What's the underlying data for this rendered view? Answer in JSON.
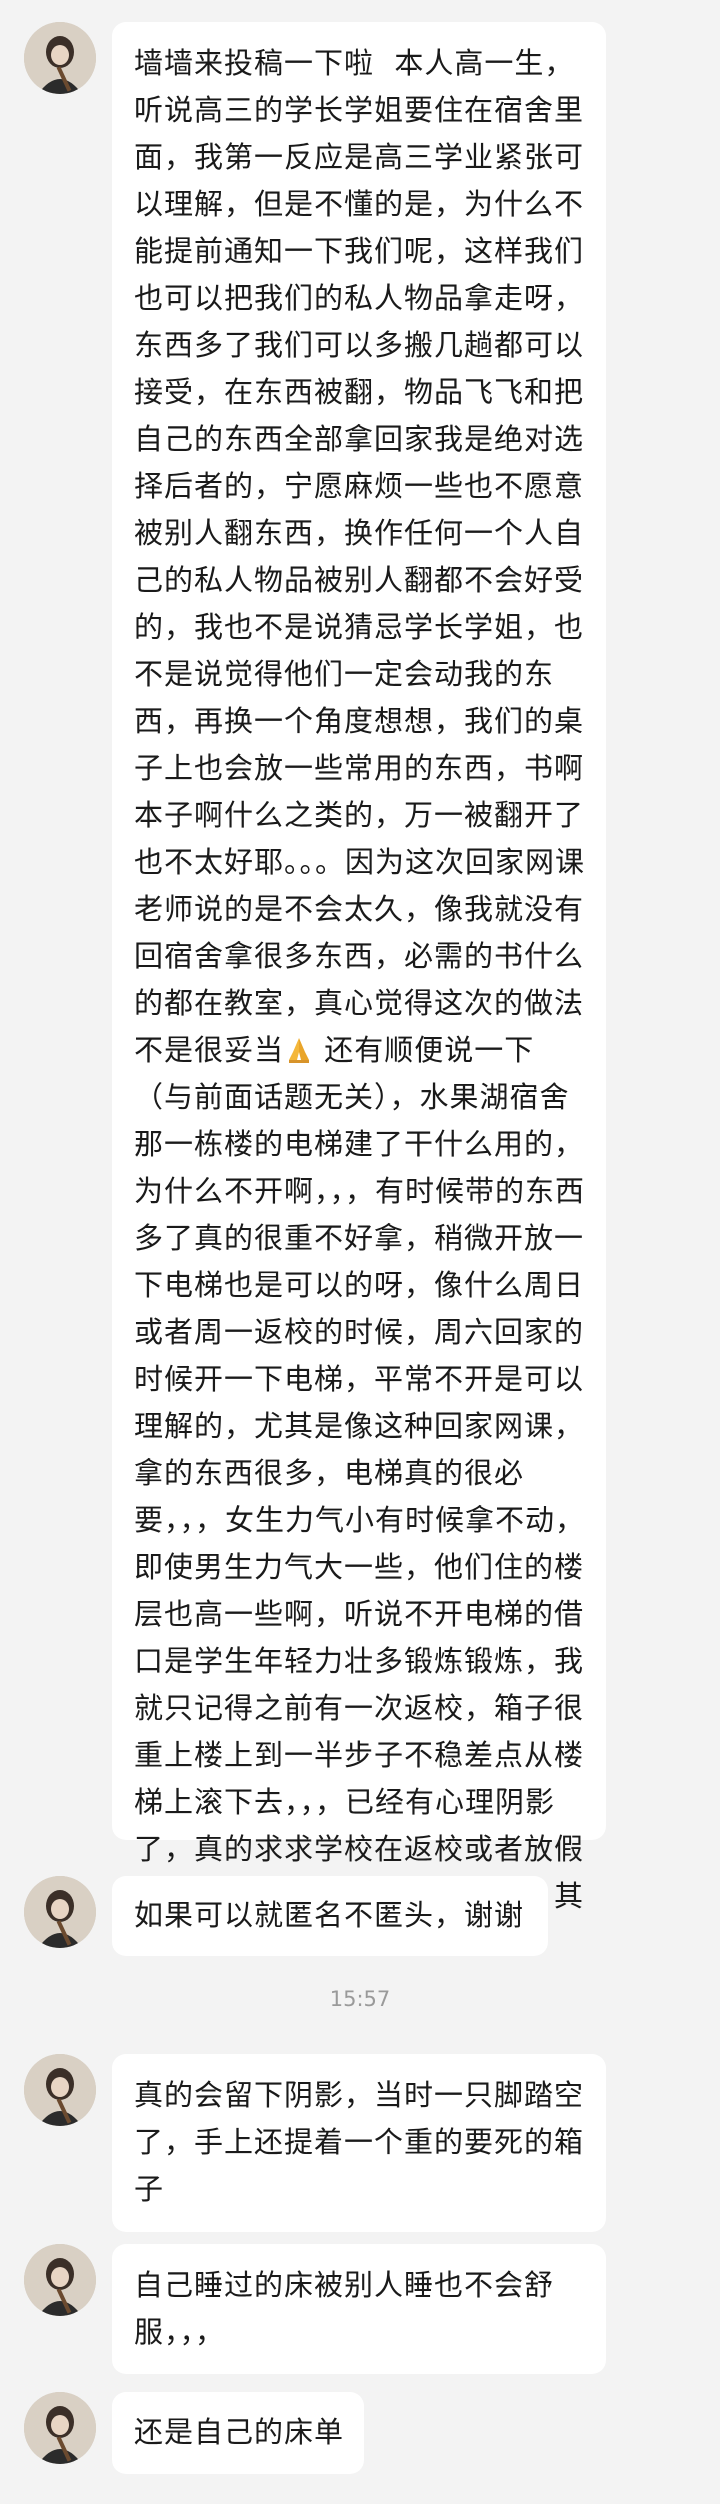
{
  "messages": [
    {
      "text_before_emoji": "墙墙来投稿一下啦  本人高一生，听说高三的学长学姐要住在宿舍里面，我第一反应是高三学业紧张可以理解，但是不懂的是，为什么不能提前通知一下我们呢，这样我们也可以把我们的私人物品拿走呀，东西多了我们可以多搬几趟都可以接受，在东西被翻，物品飞飞和把自己的东西全部拿回家我是绝对选择后者的，宁愿麻烦一些也不愿意被别人翻东西，换作任何一个人自己的私人物品被别人翻都不会好受的，我也不是说猜忌学长学姐，也不是说觉得他们一定会动我的东西，再换一个角度想想，我们的桌子上也会放一些常用的东西，书啊本子啊什么之类的，万一被翻开了也不太好耶。。。因为这次回家网课老师说的是不会太久，像我就没有回宿舍拿很多东西，必需的书什么的都在教室，真心觉得这次的做法不是很妥当",
      "emoji": "folded-hands-emoji",
      "text_after_emoji": " 还有顺便说一下（与前面话题无关），水果湖宿舍那一栋楼的电梯建了干什么用的，为什么不开啊，，，有时候带的东西多了真的很重不好拿，稍微开放一下电梯也是可以的呀，像什么周日或者周一返校的时候，周六回家的时候开一下电梯，平常不开是可以理解的，尤其是像这种回家网课，拿的东西很多，电梯真的很必要，，，女生力气小有时候拿不动，即使男生力气大一些，他们住的楼层也高一些啊，听说不开电梯的借口是学生年轻力壮多锻炼锻炼，我就只记得之前有一次返校，箱子很重上楼上到一半步子不稳差点从楼梯上滚下去，，，已经有心理阴影了，真的求求学校在返校或者放假回家网课这些时候开一下电梯，其他时候不开也可以理解"
    },
    {
      "text": "如果可以就匿名不匿头，谢谢"
    },
    {
      "text": "真的会留下阴影，当时一只脚踏空了，手上还提着一个重的要死的箱子"
    },
    {
      "text": "自己睡过的床被别人睡也不会舒服，，，"
    },
    {
      "text": "还是自己的床单"
    }
  ],
  "timestamp": "15:57"
}
